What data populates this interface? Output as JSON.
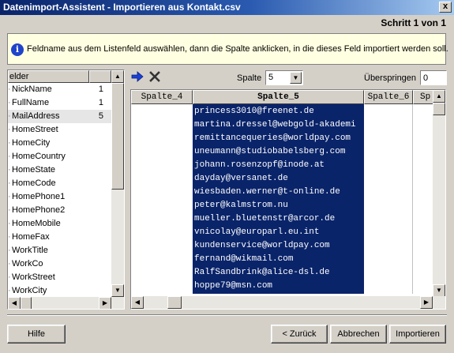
{
  "window": {
    "title": "Datenimport-Assistent - Importieren aus  Kontakt.csv",
    "close_label": "x"
  },
  "step": "Schritt 1 von 1",
  "info": {
    "text": "Feldname aus dem Listenfeld auswählen, dann die Spalte anklicken, in die dieses Feld importiert werden soll.",
    "icon": "info-icon"
  },
  "fields": {
    "header": "elder",
    "items": [
      {
        "name": "NickName",
        "col": "1"
      },
      {
        "name": "FullName",
        "col": "1"
      },
      {
        "name": "MailAddress",
        "col": "5"
      },
      {
        "name": "HomeStreet",
        "col": ""
      },
      {
        "name": "HomeCity",
        "col": ""
      },
      {
        "name": "HomeCountry",
        "col": ""
      },
      {
        "name": "HomeState",
        "col": ""
      },
      {
        "name": "HomeCode",
        "col": ""
      },
      {
        "name": "HomePhone1",
        "col": ""
      },
      {
        "name": "HomePhone2",
        "col": ""
      },
      {
        "name": "HomeMobile",
        "col": ""
      },
      {
        "name": "HomeFax",
        "col": ""
      },
      {
        "name": "WorkTitle",
        "col": ""
      },
      {
        "name": "WorkCo",
        "col": ""
      },
      {
        "name": "WorkStreet",
        "col": ""
      },
      {
        "name": "WorkCity",
        "col": ""
      }
    ],
    "selected_index": 2
  },
  "toolbar": {
    "assign_icon": "arrow-right-icon",
    "clear_icon": "x-icon",
    "column_label": "Spalte",
    "column_value": "5",
    "skip_label": "Überspringen",
    "skip_value": "0"
  },
  "grid": {
    "columns": [
      "Spalte_4",
      "Spalte_5",
      "Spalte_6",
      "Sp"
    ],
    "selected_column": "Spalte_5",
    "rows": [
      "princess3010@freenet.de",
      "martina.dressel@webgold-akademi",
      "remittancequeries@worldpay.com",
      "uneumann@studiobabelsberg.com",
      "johann.rosenzopf@inode.at",
      "dayday@versanet.de",
      "wiesbaden.werner@t-online.de",
      "peter@kalmstrom.nu",
      "mueller.bluetenstr@arcor.de",
      "vnicolay@europarl.eu.int",
      "kundenservice@worldpay.com",
      "fernand@wikmail.com",
      "RalfSandbrink@alice-dsl.de",
      "hoppe79@msn.com"
    ]
  },
  "buttons": {
    "help": "Hilfe",
    "back": "< Zurück",
    "cancel": "Abbrechen",
    "import": "Importieren"
  },
  "colors": {
    "title_start": "#0a246a",
    "selection": "#0a246a",
    "info_bg": "#ffffe1"
  }
}
